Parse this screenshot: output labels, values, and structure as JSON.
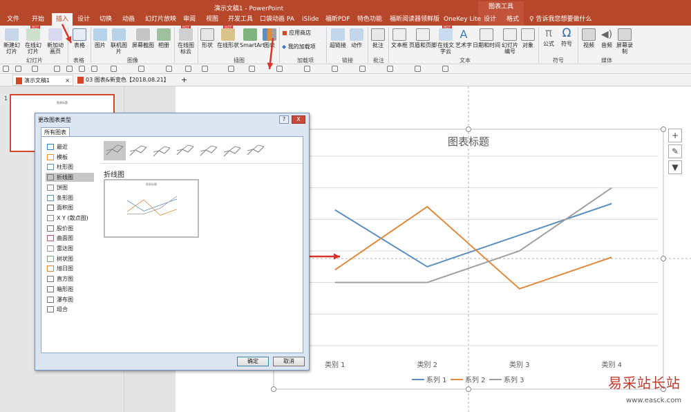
{
  "window": {
    "title": "演示文稿1 - PowerPoint",
    "context_group": "图表工具",
    "tell_me": "告诉我您想要做什么"
  },
  "tabs": [
    "文件",
    "开始",
    "插入",
    "设计",
    "切换",
    "动画",
    "幻灯片放映",
    "审阅",
    "视图",
    "开发工具",
    "口袋动画 PA",
    "iSlide",
    "福昕PDF",
    "特色功能",
    "福昕阅读器领鲜版",
    "OneKey Lite",
    "设计",
    "格式"
  ],
  "active_tab": "插入",
  "ribbon": {
    "buttons": [
      "新建幻灯片",
      "在线幻灯片",
      "新加动画页",
      "表格",
      "图片",
      "联机图片",
      "屏幕截图",
      "相册",
      "在线图标云",
      "形状",
      "在线形状",
      "SmartArt",
      "图表",
      "应用商店",
      "我的加载项",
      "超链接",
      "动作",
      "批注",
      "文本框",
      "页眉和页脚",
      "在线文字云",
      "艺术字",
      "日期和时间",
      "幻灯片编号",
      "对象",
      "公式",
      "符号",
      "视频",
      "音频",
      "屏幕录制"
    ],
    "groups": [
      "幻灯片",
      "表格",
      "图像",
      "插图",
      "加载项",
      "链接",
      "批注",
      "文本",
      "符号",
      "媒体"
    ],
    "hot_badge": "HOT"
  },
  "doc_tabs": [
    "演示文稿1",
    "03 图表&新变色【2018.08.21】"
  ],
  "thumb": {
    "number": "1",
    "title": "图表标题"
  },
  "dialog": {
    "title": "更改图表类型",
    "help": "?",
    "close": "X",
    "tab": "所有图表",
    "categories": [
      "最近",
      "模板",
      "柱形图",
      "折线图",
      "饼图",
      "条形图",
      "面积图",
      "X Y (散点图)",
      "股价图",
      "曲面图",
      "雷达图",
      "树状图",
      "旭日图",
      "直方图",
      "箱形图",
      "瀑布图",
      "组合"
    ],
    "selected_category": "折线图",
    "selected_type_name": "折线图",
    "preview_title": "图表标题",
    "ok": "确定",
    "cancel": "取消"
  },
  "chart_data": {
    "type": "line",
    "title": "图表标题",
    "categories": [
      "类别 1",
      "类别 2",
      "类别 3",
      "类别 4"
    ],
    "series": [
      {
        "name": "系列 1",
        "values": [
          4.3,
          2.5,
          3.5,
          4.5
        ],
        "color": "#5b8fc0"
      },
      {
        "name": "系列 2",
        "values": [
          2.4,
          4.4,
          1.8,
          2.8
        ],
        "color": "#e08a3e"
      },
      {
        "name": "系列 3",
        "values": [
          2.0,
          2.0,
          3.0,
          5.0
        ],
        "color": "#a0a0a0"
      }
    ],
    "ylim": [
      0,
      6
    ],
    "grid": true,
    "legend": "bottom",
    "visible_category_labels": [
      "类别 1",
      "类别 2",
      "类别 3",
      "类别 4"
    ]
  },
  "side_buttons": [
    "+",
    "✎",
    "▼"
  ],
  "watermark": {
    "text": "易采站长站",
    "url": "www.easck.com"
  }
}
